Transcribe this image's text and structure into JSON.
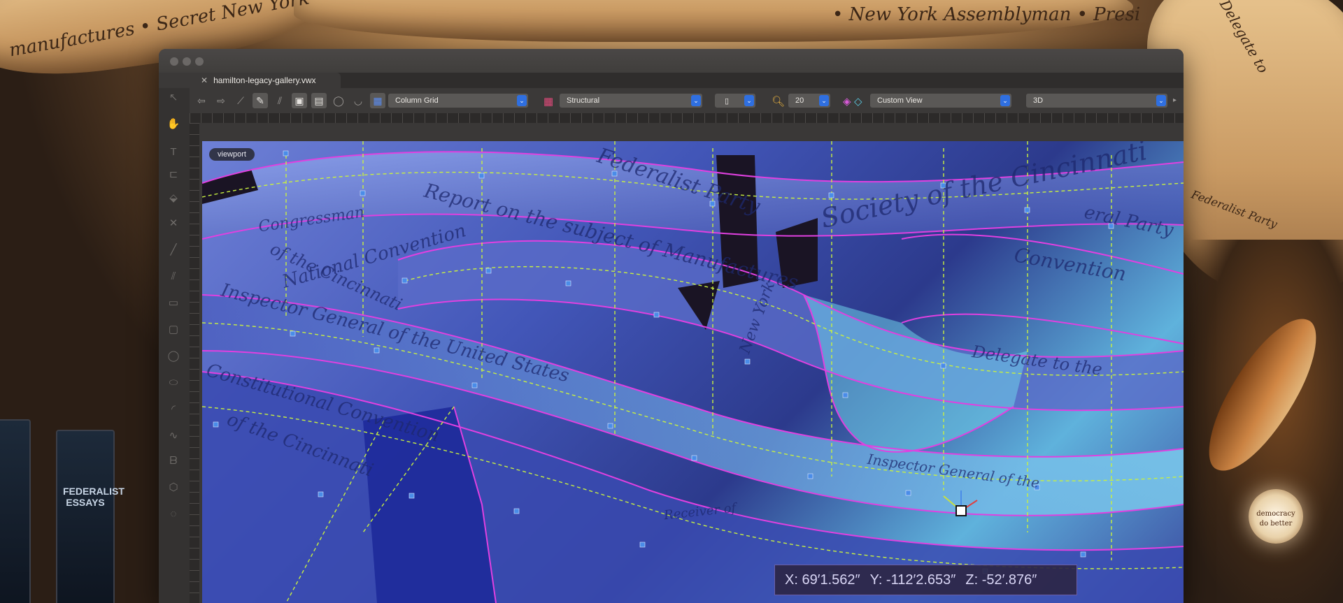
{
  "background": {
    "banner_texts": [
      "manufactures • Secret New York",
      "• New York Assemblyman • Presi",
      "Delegate to",
      "Federalist Party"
    ],
    "plaque_title": "FEDERALIST ESSAYS",
    "seal_text": [
      "democracy",
      "do better"
    ]
  },
  "window": {
    "file_tab": {
      "close": "✕",
      "name": "hamilton-legacy-gallery.vwx"
    }
  },
  "toolbar": {
    "class_select": "Column Grid",
    "layer_select": "Structural",
    "page_select": "",
    "zoom": "20",
    "view_select": "Custom View",
    "render_select": "3D",
    "overflow": "▸"
  },
  "viewport": {
    "label": "viewport",
    "script_text": [
      "Federalist Party",
      "Congressman",
      "National Convention",
      "Society of the Cincinnati",
      "Report on the subject of Manufactures",
      "of the Cincinnati",
      "Inspector General of the United States",
      "Constitutional Convention",
      "of the Cincinnati",
      "New York",
      "Delegate to the",
      "Inspector General of the",
      "Receiver of",
      "Convention",
      "eral Party"
    ]
  },
  "coordinates": {
    "x": "X: 69′1.562″",
    "y": "Y: -112′2.653″",
    "z": "Z: -52′.876″"
  },
  "colors": {
    "accent": "#2f6fe0",
    "outline": "#e040e0",
    "guide": "#c8f040",
    "handle": "#4a8ce8"
  }
}
